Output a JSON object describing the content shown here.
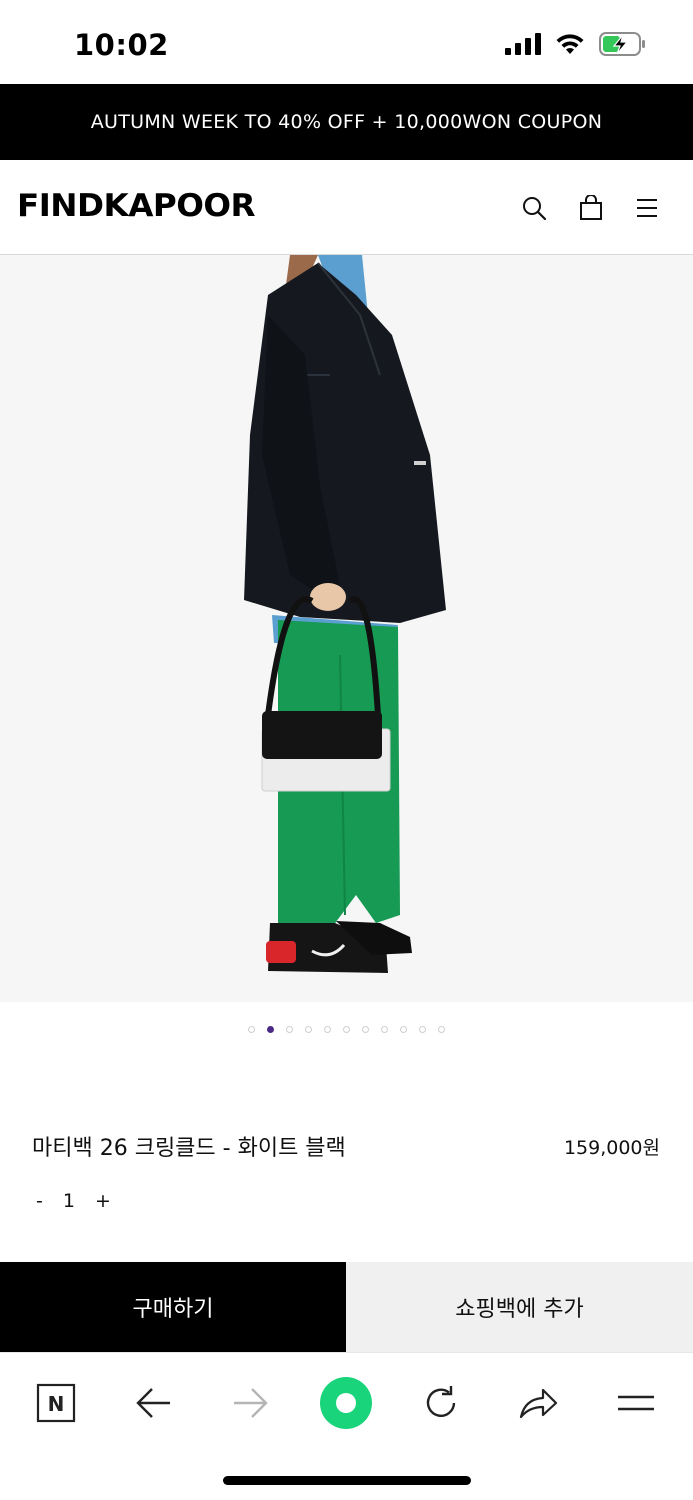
{
  "status_bar": {
    "time": "10:02"
  },
  "promo": {
    "text": "AUTUMN WEEK TO 40% OFF + 10,000WON COUPON"
  },
  "header": {
    "logo": "FINDKAPOOR"
  },
  "carousel": {
    "count": 11,
    "active_index": 1
  },
  "product": {
    "name": "마티백 26 크링클드 - 화이트 블랙",
    "price": "159,000원",
    "quantity": {
      "minus": "-",
      "value": "1",
      "plus": "+"
    }
  },
  "actions": {
    "buy_label": "구매하기",
    "cart_label": "쇼핑백에 추가"
  },
  "browser": {
    "home_label": "N",
    "accent_color": "#19d47a"
  },
  "colors": {
    "banner_bg": "#000000",
    "image_bg": "#f6f6f6",
    "dot_active": "#4a2a86",
    "cart_button_bg": "#f0f0f0"
  },
  "icons": [
    "signal-icon",
    "wifi-icon",
    "battery-charging-icon",
    "search-icon",
    "shopping-bag-icon",
    "menu-icon",
    "naver-home-icon",
    "back-arrow-icon",
    "forward-arrow-icon",
    "green-dot-icon",
    "reload-icon",
    "share-icon",
    "browser-menu-icon"
  ]
}
